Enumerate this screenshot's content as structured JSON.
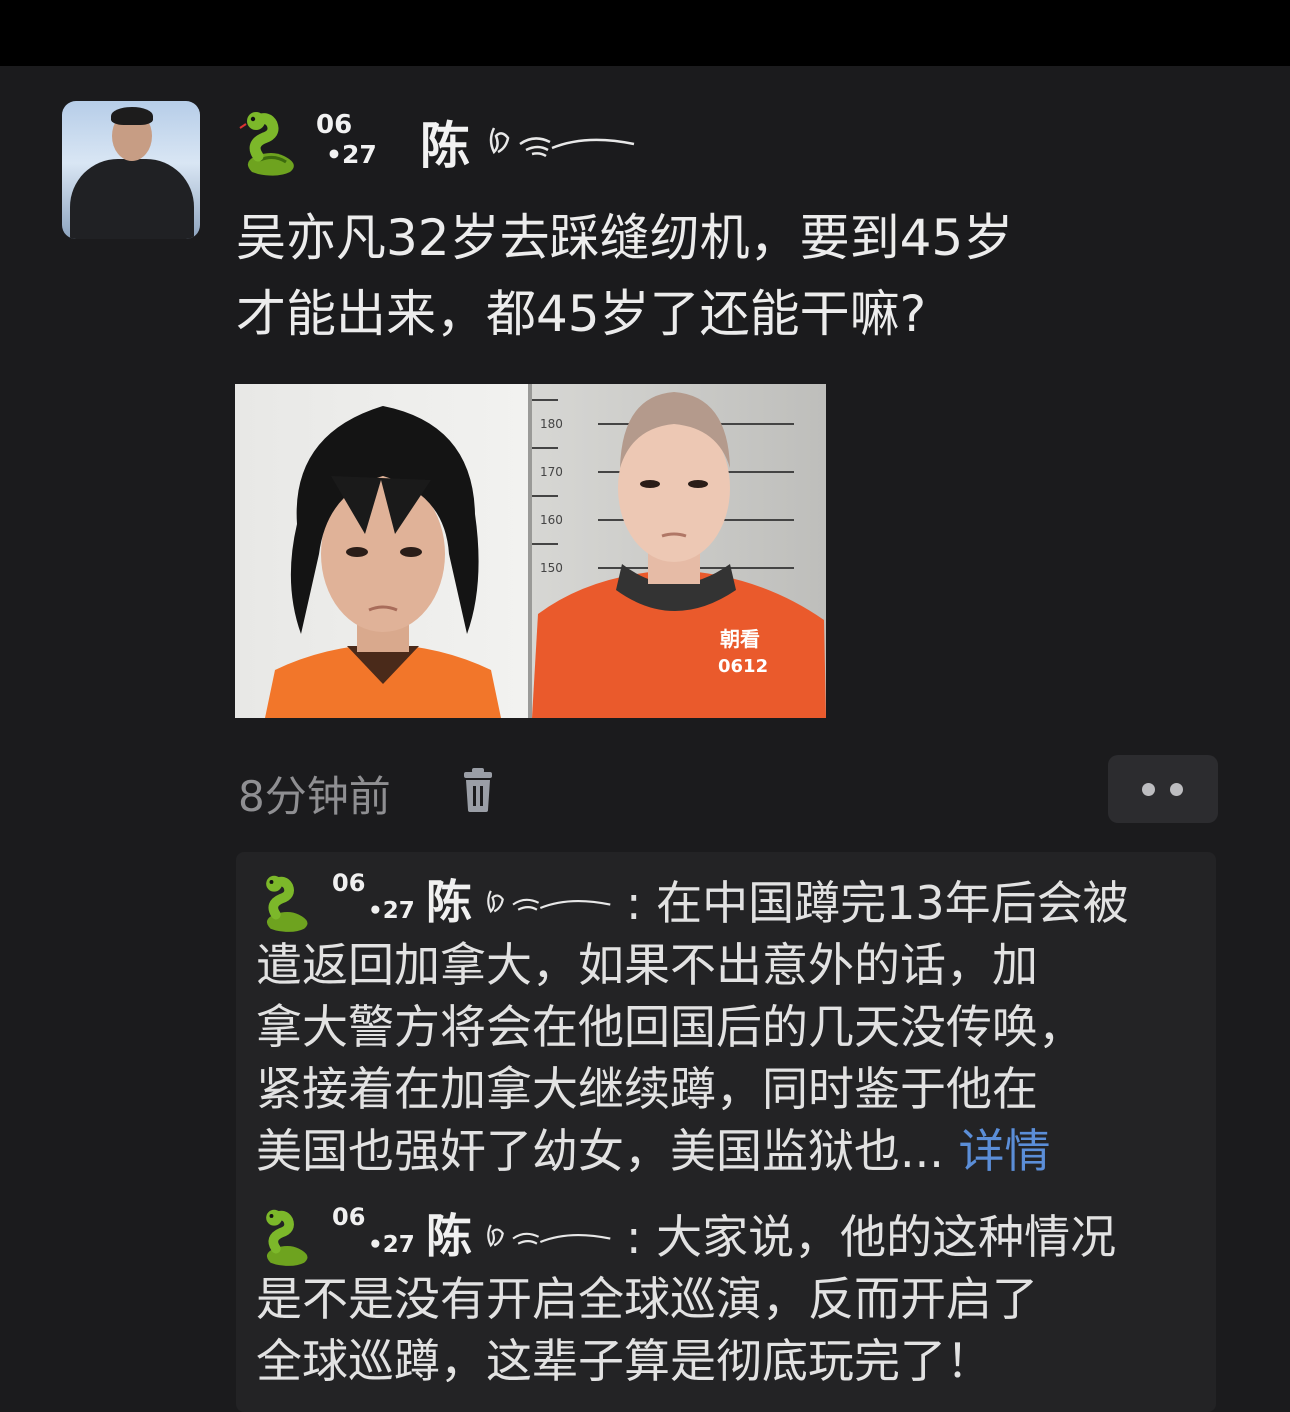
{
  "post": {
    "author": {
      "date_top": "06",
      "date_bottom": "•27",
      "surname": "陈"
    },
    "text_line1": "吴亦凡32岁去踩缝纫机，要到45岁",
    "text_line2": "才能出来，都45岁了还能干嘛?",
    "photo_right_labels": {
      "h180": "180",
      "h170": "170",
      "h160": "160",
      "h150": "150",
      "badge_line1": "朝看",
      "badge_line2": "0612"
    },
    "time": "8分钟前"
  },
  "comments": [
    {
      "date_top": "06",
      "date_bottom": "•27",
      "surname": "陈",
      "first_line": ": 在中国蹲完13年后会被",
      "lines": [
        "遣返回加拿大，如果不出意外的话，加",
        "拿大警方将会在他回国后的几天没传唤，",
        "紧接着在加拿大继续蹲，同时鉴于他在"
      ],
      "last_line": "美国也强奸了幼女，美国监狱也...",
      "more_link": "详情"
    },
    {
      "date_top": "06",
      "date_bottom": "•27",
      "surname": "陈",
      "first_line": ": 大家说，他的这种情况",
      "lines": [
        "是不是没有开启全球巡演，反而开启了",
        "全球巡蹲，这辈子算是彻底玩完了！"
      ]
    }
  ],
  "colors": {
    "background": "#1b1b1d",
    "link": "#5b8ed8",
    "muted_text": "#8f8f92"
  }
}
